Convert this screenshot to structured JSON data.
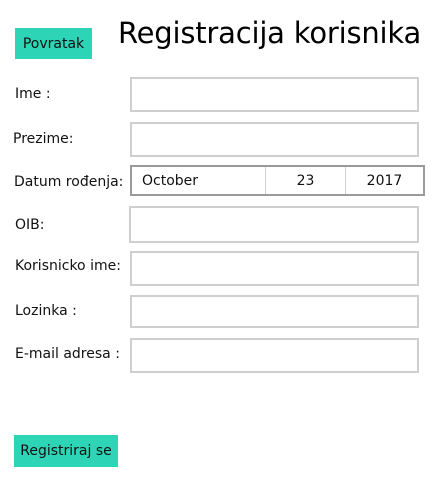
{
  "header": {
    "back_label": "Povratak",
    "title": "Registracija korisnika"
  },
  "form": {
    "first_name": {
      "label": "Ime :",
      "value": ""
    },
    "last_name": {
      "label": "Prezime:",
      "value": ""
    },
    "birth_date": {
      "label": "Datum rođenja:",
      "month": "October",
      "day": "23",
      "year": "2017"
    },
    "oib": {
      "label": "OIB:",
      "value": ""
    },
    "username": {
      "label": "Korisnicko ime:",
      "value": ""
    },
    "password": {
      "label": "Lozinka :",
      "value": ""
    },
    "email": {
      "label": "E-mail adresa :",
      "value": ""
    }
  },
  "footer": {
    "register_label": "Registriraj se"
  },
  "colors": {
    "accent": "#2ed4b6",
    "field_border": "#cfcfcf",
    "date_border": "#9a9a9a"
  }
}
